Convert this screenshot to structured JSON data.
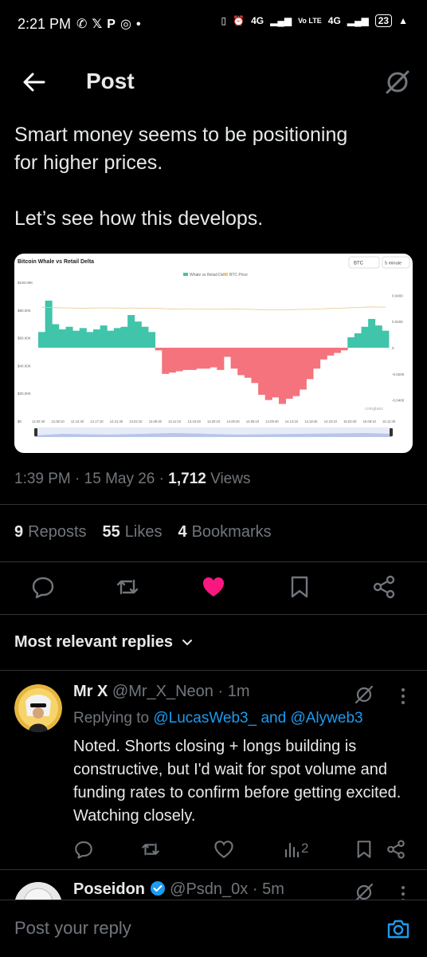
{
  "status_bar": {
    "time": "2:21 PM",
    "left_icons": [
      "whatsapp-icon",
      "x-icon",
      "p-icon",
      "instagram-icon"
    ],
    "network_1": "4G",
    "volte": "Vo LTE",
    "network_2": "4G",
    "battery": "23"
  },
  "header": {
    "title": "Post"
  },
  "post": {
    "text": "Smart money seems to be positioning\nfor higher prices.\n\nLet’s see how this develops.",
    "time": "1:39 PM",
    "date": "15 May 26",
    "views_count": "1,712",
    "views_label": "Views",
    "reposts_count": "9",
    "reposts_label": "Reposts",
    "likes_count": "55",
    "likes_label": "Likes",
    "bookmarks_count": "4",
    "bookmarks_label": "Bookmarks",
    "liked": true,
    "like_color": "#f91880"
  },
  "chart": {
    "title": "Bitcoin Whale vs Retail Delta",
    "select_symbol": "BTC",
    "select_interval": "5 minute",
    "legend": [
      "Whale vs Retail Delta",
      "BTC Price"
    ],
    "watermark": "coinglass",
    "left_ticks": [
      "$100.00K",
      "$80.00K",
      "$60.00K",
      "$40.00K",
      "$20.00K",
      "$0"
    ],
    "right_ticks": [
      "0.0400",
      "0.0200",
      "0",
      "-0.0200",
      "-0.0400"
    ],
    "x_ticks": [
      "12.02:40",
      "12.08:10",
      "12.12:40",
      "12.17:10",
      "12.21:40",
      "13.02:10",
      "13.06:40",
      "13.11:10",
      "13.15:40",
      "13.20:10",
      "14.00:40",
      "14.05:10",
      "14.09:40",
      "14.14:10",
      "14.18:40",
      "14.23:10",
      "15.03:40",
      "15.08:10",
      "15.12:40"
    ],
    "positive_color": "#40c4aa",
    "negative_color": "#f4737d",
    "price_color": "#e8c98a"
  },
  "chart_data": {
    "type": "area",
    "title": "Bitcoin Whale vs Retail Delta",
    "series": [
      {
        "name": "Whale vs Retail Delta",
        "values": [
          0.012,
          0.036,
          0.018,
          0.014,
          0.016,
          0.013,
          0.015,
          0.012,
          0.014,
          0.017,
          0.013,
          0.015,
          0.016,
          0.025,
          0.02,
          0.016,
          0.012,
          -0.002,
          -0.02,
          -0.019,
          -0.018,
          -0.017,
          -0.017,
          -0.016,
          -0.016,
          -0.015,
          -0.017,
          -0.007,
          -0.016,
          -0.021,
          -0.023,
          -0.027,
          -0.036,
          -0.04,
          -0.038,
          -0.043,
          -0.039,
          -0.037,
          -0.032,
          -0.024,
          -0.016,
          -0.009,
          -0.006,
          -0.004,
          -0.002,
          0.008,
          0.011,
          0.016,
          0.022,
          0.017,
          0.013
        ]
      },
      {
        "name": "BTC Price",
        "values": [
          81000,
          80800,
          80600,
          80500,
          80400,
          80300,
          80200,
          80300,
          80400,
          80500,
          80400,
          80300,
          80200,
          80400,
          80300,
          80200,
          80100,
          80000,
          79800,
          79700,
          79600,
          79700,
          79800,
          79600,
          79500,
          79400,
          79500,
          79600,
          79700,
          79500,
          79300,
          79200,
          79100,
          79000,
          78900,
          79000,
          79100,
          79200,
          79300,
          79400,
          79600,
          79800,
          80000,
          80200,
          80400,
          80600,
          80800,
          81000,
          81200,
          81100,
          81000
        ]
      }
    ],
    "x_ticks": [
      "12.02:40",
      "12.08:10",
      "12.12:40",
      "12.17:10",
      "12.21:40",
      "13.02:10",
      "13.06:40",
      "13.11:10",
      "13.15:40",
      "13.20:10",
      "14.00:40",
      "14.05:10",
      "14.09:40",
      "14.14:10",
      "14.18:40",
      "14.23:10",
      "15.03:40",
      "15.08:10",
      "15.12:40"
    ],
    "left_ylim": [
      0,
      100000
    ],
    "right_ylim": [
      -0.05,
      0.05
    ],
    "legend_position": "top-center",
    "grid": false
  },
  "replies_section": {
    "title": "Most relevant replies"
  },
  "replies": [
    {
      "name": "Mr X",
      "verified": false,
      "handle": "@Mr_X_Neon",
      "time": "1m",
      "replying_prefix": "Replying to",
      "replying_1": "@LucasWeb3_",
      "replying_and": "and",
      "replying_2": "@Alyweb3",
      "text": "Noted. Shorts closing + longs building is constructive, but I'd wait for spot volume and funding rates to confirm before getting excited. Watching closely.",
      "views": "2"
    },
    {
      "name": "Poseidon",
      "verified": true,
      "handle": "@Psdn_0x",
      "time": "5m"
    }
  ],
  "reply_bar": {
    "placeholder": "Post your reply"
  },
  "colors": {
    "background": "#000000",
    "text": "#e7e9ea",
    "muted": "#71767b",
    "link": "#1d9bf0",
    "divider": "#2f3336",
    "verified": "#1d9bf0"
  }
}
